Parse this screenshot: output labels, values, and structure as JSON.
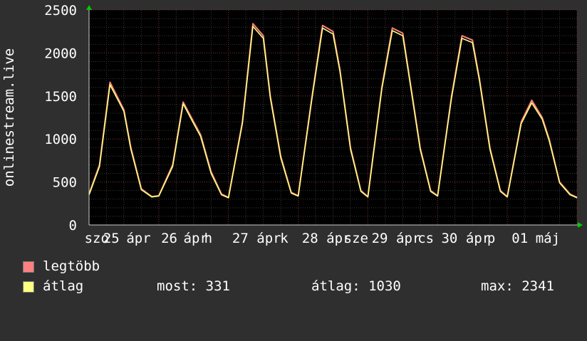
{
  "colors": {
    "background": "#2f2f2f",
    "plot_background": "#000000",
    "grid_minor": "#3a3a3a",
    "grid_major": "#7a2a2a",
    "axis_text": "#ffffff",
    "series_max": "#ff8080",
    "series_avg": "#ffff80"
  },
  "legend": {
    "items": [
      {
        "label": "legtöbb",
        "color": "#ff8080"
      },
      {
        "label": "átlag",
        "color": "#ffff80"
      }
    ],
    "stats": {
      "most": "most: 331",
      "atlag": "átlag: 1030",
      "max": "max: 2341"
    }
  },
  "chart_data": {
    "type": "line",
    "ylabel": "onlinestream.live",
    "ylim": [
      0,
      2500
    ],
    "y_ticks": [
      0,
      500,
      1000,
      1500,
      2000,
      2500
    ],
    "grid": true,
    "x_tick_labels": [
      "szo",
      "25",
      "ápr",
      "26",
      "ápr",
      "h",
      "27",
      "ápr",
      "k",
      "28",
      "ápr",
      "sze",
      "29",
      "ápr",
      "cs",
      "30",
      "ápr",
      "p",
      "01",
      "máj"
    ],
    "days": [
      "szo 25 ápr",
      "h 26 ápr",
      "k 27 ápr",
      "sze 28 ápr",
      "cs 29 ápr",
      "p 30 ápr",
      "01 máj"
    ],
    "series": [
      {
        "name": "legtöbb",
        "x": [
          0,
          0.15,
          0.3,
          0.45,
          0.5,
          0.6,
          0.75,
          0.9,
          1.0,
          1.2,
          1.35,
          1.5,
          1.6,
          1.75,
          1.9,
          2.0,
          2.2,
          2.35,
          2.5,
          2.6,
          2.75,
          2.9,
          3.0,
          3.2,
          3.35,
          3.5,
          3.6,
          3.75,
          3.9,
          4.0,
          4.2,
          4.35,
          4.5,
          4.6,
          4.75,
          4.9,
          5.0,
          5.2,
          5.35,
          5.5,
          5.6,
          5.75,
          5.9,
          6.0,
          6.2,
          6.35,
          6.5,
          6.6,
          6.75,
          6.9,
          7.0
        ],
        "values": [
          360,
          700,
          1660,
          1420,
          1340,
          900,
          420,
          330,
          340,
          700,
          1430,
          1200,
          1050,
          620,
          360,
          320,
          1200,
          2341,
          2200,
          1500,
          800,
          380,
          340,
          1500,
          2320,
          2250,
          1800,
          900,
          400,
          330,
          1600,
          2290,
          2230,
          1700,
          900,
          400,
          340,
          1500,
          2200,
          2150,
          1700,
          900,
          400,
          330,
          1200,
          1450,
          1250,
          1000,
          500,
          360,
          320
        ]
      },
      {
        "name": "átlag",
        "x": [
          0,
          0.15,
          0.3,
          0.45,
          0.5,
          0.6,
          0.75,
          0.9,
          1.0,
          1.2,
          1.35,
          1.5,
          1.6,
          1.75,
          1.9,
          2.0,
          2.2,
          2.35,
          2.5,
          2.6,
          2.75,
          2.9,
          3.0,
          3.2,
          3.35,
          3.5,
          3.6,
          3.75,
          3.9,
          4.0,
          4.2,
          4.35,
          4.5,
          4.6,
          4.75,
          4.9,
          5.0,
          5.2,
          5.35,
          5.5,
          5.6,
          5.75,
          5.9,
          6.0,
          6.2,
          6.35,
          6.5,
          6.6,
          6.75,
          6.9,
          7.0
        ],
        "values": [
          350,
          680,
          1630,
          1400,
          1320,
          880,
          410,
          325,
          335,
          680,
          1410,
          1180,
          1030,
          600,
          350,
          315,
          1180,
          2310,
          2170,
          1480,
          780,
          370,
          335,
          1480,
          2290,
          2220,
          1780,
          880,
          390,
          325,
          1580,
          2260,
          2200,
          1680,
          880,
          390,
          335,
          1480,
          2170,
          2120,
          1680,
          880,
          390,
          325,
          1180,
          1420,
          1230,
          980,
          490,
          350,
          315
        ]
      }
    ]
  }
}
